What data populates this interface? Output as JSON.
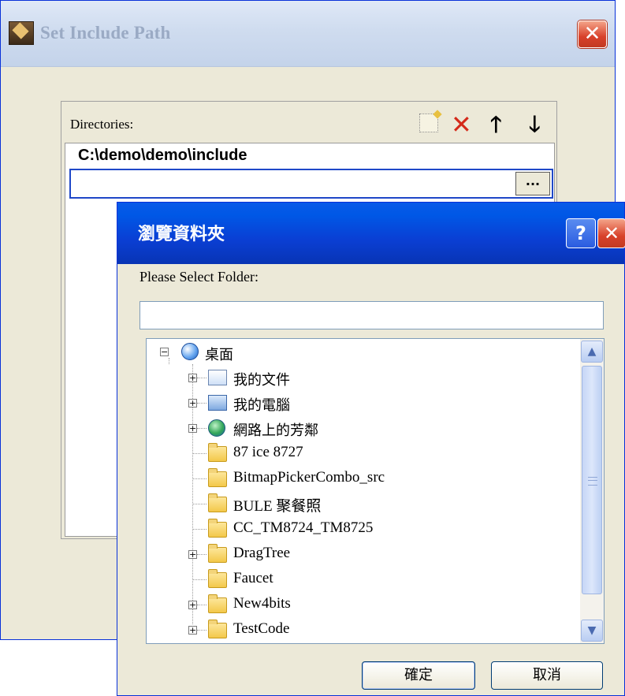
{
  "back_window": {
    "title": "Set Include Path",
    "close_glyph": "✕",
    "directories_label": "Directories:",
    "toolbar_icons": [
      "new-folder-icon",
      "delete-icon",
      "move-up-icon",
      "move-down-icon"
    ],
    "toolbar_glyphs": {
      "delete": "✕",
      "up": "🡑",
      "down": "🡓"
    },
    "list_items": [
      "C:\\demo\\demo\\include"
    ],
    "edit_value": "",
    "browse_button_label": "..."
  },
  "browse_dialog": {
    "title": "瀏覽資料夾",
    "help_glyph": "?",
    "close_glyph": "✕",
    "prompt": "Please Select Folder:",
    "folder_value": "",
    "tree": {
      "root": {
        "label": "桌面",
        "icon": "desktop-icon",
        "expanded": true
      },
      "items": [
        {
          "label": "我的文件",
          "icon": "my-documents-icon",
          "expandable": true
        },
        {
          "label": "我的電腦",
          "icon": "my-computer-icon",
          "expandable": true
        },
        {
          "label": "網路上的芳鄰",
          "icon": "network-places-icon",
          "expandable": true
        },
        {
          "label": "87 ice 8727",
          "icon": "folder-icon",
          "expandable": false
        },
        {
          "label": "BitmapPickerCombo_src",
          "icon": "folder-icon",
          "expandable": false
        },
        {
          "label": "BULE 聚餐照",
          "icon": "folder-icon",
          "expandable": false
        },
        {
          "label": "CC_TM8724_TM8725",
          "icon": "folder-icon",
          "expandable": false
        },
        {
          "label": "DragTree",
          "icon": "folder-icon",
          "expandable": true
        },
        {
          "label": "Faucet",
          "icon": "folder-icon",
          "expandable": false
        },
        {
          "label": "New4bits",
          "icon": "folder-icon",
          "expandable": true
        },
        {
          "label": "TestCode",
          "icon": "folder-icon",
          "expandable": true
        }
      ]
    },
    "ok_label": "確定",
    "cancel_label": "取消"
  },
  "colors": {
    "xp_title_blue": "#0058e6",
    "xp_close_red": "#d8412a",
    "dialog_face": "#ece9d8"
  }
}
